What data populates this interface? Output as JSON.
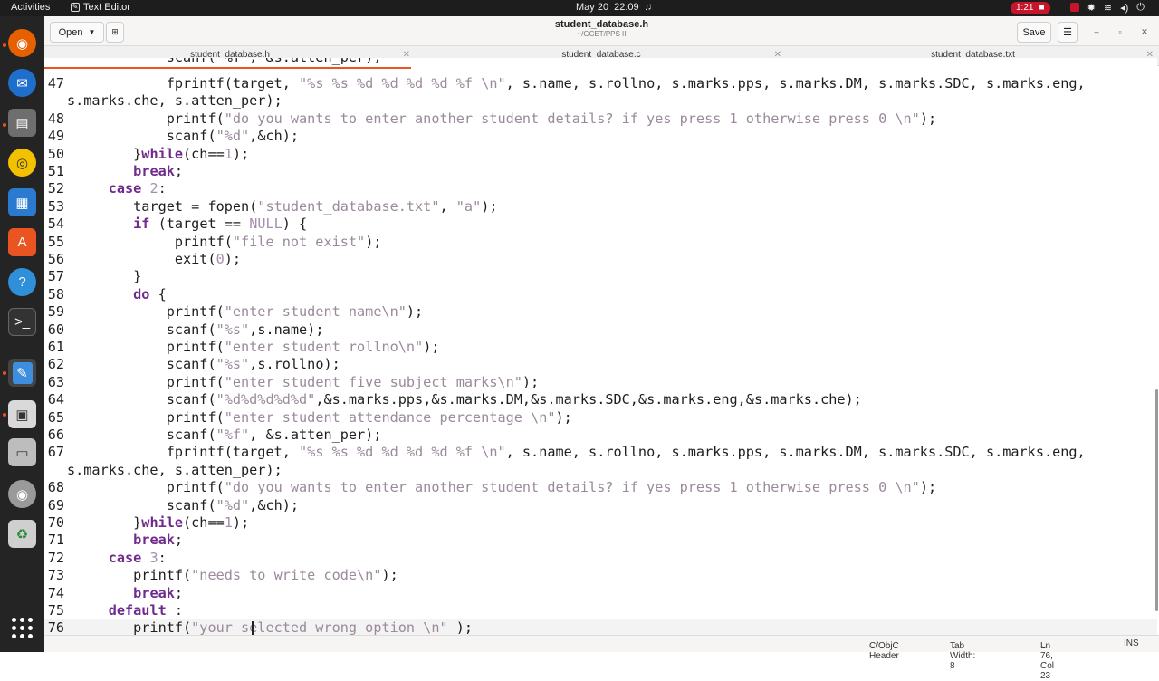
{
  "system": {
    "activities": "Activities",
    "app_name": "Text Editor",
    "date": "May 20",
    "time": "22:09",
    "recording_time": "1:21"
  },
  "header": {
    "open_label": "Open",
    "title": "student_database.h",
    "subtitle": "~/GCET/PPS II",
    "save_label": "Save"
  },
  "tabs": [
    {
      "label": "student_database.h"
    },
    {
      "label": "student_database.c"
    },
    {
      "label": "student_database.txt"
    }
  ],
  "editor": {
    "partial_line_top": "            scanf(\"%f\", &s.atten_per);",
    "lines": [
      {
        "n": "47",
        "segs": [
          [
            "",
            "            fprintf(target, "
          ],
          [
            "str",
            "\"%s %s %d %d %d %d %f \\n\""
          ],
          [
            "",
            ", s.name, s.rollno, s.marks.pps, s.marks.DM, s.marks.SDC, s.marks.eng,"
          ]
        ]
      },
      {
        "n": "",
        "segs": [
          [
            "",
            "s.marks.che, s.atten_per);"
          ]
        ]
      },
      {
        "n": "48",
        "segs": [
          [
            "",
            "            printf("
          ],
          [
            "str",
            "\"do you wants to enter another student details? if yes press 1 otherwise press 0 \\n\""
          ],
          [
            "",
            ");"
          ]
        ]
      },
      {
        "n": "49",
        "segs": [
          [
            "",
            "            scanf("
          ],
          [
            "str",
            "\"%d\""
          ],
          [
            "",
            ",&ch);"
          ]
        ]
      },
      {
        "n": "50",
        "segs": [
          [
            "",
            "        }"
          ],
          [
            "kw",
            "while"
          ],
          [
            "",
            "(ch=="
          ],
          [
            "num",
            "1"
          ],
          [
            "",
            ");"
          ]
        ]
      },
      {
        "n": "51",
        "segs": [
          [
            "",
            "        "
          ],
          [
            "kw",
            "break"
          ],
          [
            "",
            ";"
          ]
        ]
      },
      {
        "n": "52",
        "segs": [
          [
            "",
            "     "
          ],
          [
            "kw",
            "case"
          ],
          [
            "",
            " "
          ],
          [
            "num",
            "2"
          ],
          [
            "",
            ":"
          ]
        ]
      },
      {
        "n": "53",
        "segs": [
          [
            "",
            "        target = fopen("
          ],
          [
            "str",
            "\"student_database.txt\""
          ],
          [
            "",
            ", "
          ],
          [
            "str",
            "\"a\""
          ],
          [
            "",
            ");"
          ]
        ]
      },
      {
        "n": "54",
        "segs": [
          [
            "",
            "        "
          ],
          [
            "kw",
            "if"
          ],
          [
            "",
            " (target == "
          ],
          [
            "num",
            "NULL"
          ],
          [
            "",
            ") {"
          ]
        ]
      },
      {
        "n": "55",
        "segs": [
          [
            "",
            "             printf("
          ],
          [
            "str",
            "\"file not exist\""
          ],
          [
            "",
            ");"
          ]
        ]
      },
      {
        "n": "56",
        "segs": [
          [
            "",
            "             exit("
          ],
          [
            "num",
            "0"
          ],
          [
            "",
            ");"
          ]
        ]
      },
      {
        "n": "57",
        "segs": [
          [
            "",
            "        }"
          ]
        ]
      },
      {
        "n": "58",
        "segs": [
          [
            "",
            "        "
          ],
          [
            "kw",
            "do"
          ],
          [
            "",
            " {"
          ]
        ]
      },
      {
        "n": "59",
        "segs": [
          [
            "",
            "            printf("
          ],
          [
            "str",
            "\"enter student name\\n\""
          ],
          [
            "",
            ");"
          ]
        ]
      },
      {
        "n": "60",
        "segs": [
          [
            "",
            "            scanf("
          ],
          [
            "str",
            "\"%s\""
          ],
          [
            "",
            ",s.name);"
          ]
        ]
      },
      {
        "n": "61",
        "segs": [
          [
            "",
            "            printf("
          ],
          [
            "str",
            "\"enter student rollno\\n\""
          ],
          [
            "",
            ");"
          ]
        ]
      },
      {
        "n": "62",
        "segs": [
          [
            "",
            "            scanf("
          ],
          [
            "str",
            "\"%s\""
          ],
          [
            "",
            ",s.rollno);"
          ]
        ]
      },
      {
        "n": "63",
        "segs": [
          [
            "",
            "            printf("
          ],
          [
            "str",
            "\"enter student five subject marks\\n\""
          ],
          [
            "",
            ");"
          ]
        ]
      },
      {
        "n": "64",
        "segs": [
          [
            "",
            "            scanf("
          ],
          [
            "str",
            "\"%d%d%d%d%d\""
          ],
          [
            "",
            ",&s.marks.pps,&s.marks.DM,&s.marks.SDC,&s.marks.eng,&s.marks.che);"
          ]
        ]
      },
      {
        "n": "65",
        "segs": [
          [
            "",
            "            printf("
          ],
          [
            "str",
            "\"enter student attendance percentage \\n\""
          ],
          [
            "",
            ");"
          ]
        ]
      },
      {
        "n": "66",
        "segs": [
          [
            "",
            "            scanf("
          ],
          [
            "str",
            "\"%f\""
          ],
          [
            "",
            ", &s.atten_per);"
          ]
        ]
      },
      {
        "n": "67",
        "segs": [
          [
            "",
            "            fprintf(target, "
          ],
          [
            "str",
            "\"%s %s %d %d %d %d %f \\n\""
          ],
          [
            "",
            ", s.name, s.rollno, s.marks.pps, s.marks.DM, s.marks.SDC, s.marks.eng,"
          ]
        ]
      },
      {
        "n": "",
        "segs": [
          [
            "",
            "s.marks.che, s.atten_per);"
          ]
        ]
      },
      {
        "n": "68",
        "segs": [
          [
            "",
            "            printf("
          ],
          [
            "str",
            "\"do you wants to enter another student details? if yes press 1 otherwise press 0 \\n\""
          ],
          [
            "",
            ");"
          ]
        ]
      },
      {
        "n": "69",
        "segs": [
          [
            "",
            "            scanf("
          ],
          [
            "str",
            "\"%d\""
          ],
          [
            "",
            ",&ch);"
          ]
        ]
      },
      {
        "n": "70",
        "segs": [
          [
            "",
            "        }"
          ],
          [
            "kw",
            "while"
          ],
          [
            "",
            "(ch=="
          ],
          [
            "num",
            "1"
          ],
          [
            "",
            ");"
          ]
        ]
      },
      {
        "n": "71",
        "segs": [
          [
            "",
            "        "
          ],
          [
            "kw",
            "break"
          ],
          [
            "",
            ";"
          ]
        ]
      },
      {
        "n": "72",
        "segs": [
          [
            "",
            "     "
          ],
          [
            "kw",
            "case"
          ],
          [
            "",
            " "
          ],
          [
            "num",
            "3"
          ],
          [
            "",
            ":"
          ]
        ]
      },
      {
        "n": "73",
        "segs": [
          [
            "",
            "        printf("
          ],
          [
            "str",
            "\"needs to write code\\n\""
          ],
          [
            "",
            ");"
          ]
        ]
      },
      {
        "n": "74",
        "segs": [
          [
            "",
            "        "
          ],
          [
            "kw",
            "break"
          ],
          [
            "",
            ";"
          ]
        ]
      },
      {
        "n": "75",
        "segs": [
          [
            "",
            "     "
          ],
          [
            "kw",
            "default"
          ],
          [
            "",
            " :"
          ]
        ]
      },
      {
        "n": "76",
        "segs": [
          [
            "",
            "        printf("
          ],
          [
            "str",
            "\"your selected wrong option \\n\""
          ],
          [
            "",
            " );"
          ]
        ],
        "current": true
      }
    ]
  },
  "status": {
    "language": "C/ObjC Header",
    "tab_width": "Tab Width: 8",
    "cursor": "Ln 76, Col 23",
    "mode": "INS"
  },
  "dock": {
    "items": [
      "firefox-icon",
      "thunderbird-icon",
      "files-icon",
      "rhythmbox-icon",
      "writer-icon",
      "app-center-icon",
      "help-icon",
      "terminal-icon",
      "text-editor-icon",
      "screenshot-app-icon",
      "drive-icon",
      "disc-icon",
      "trash-icon"
    ]
  },
  "colors": {
    "keyword": "#6f2a8c",
    "string": "#9a8a9b",
    "accent": "#e95420"
  }
}
